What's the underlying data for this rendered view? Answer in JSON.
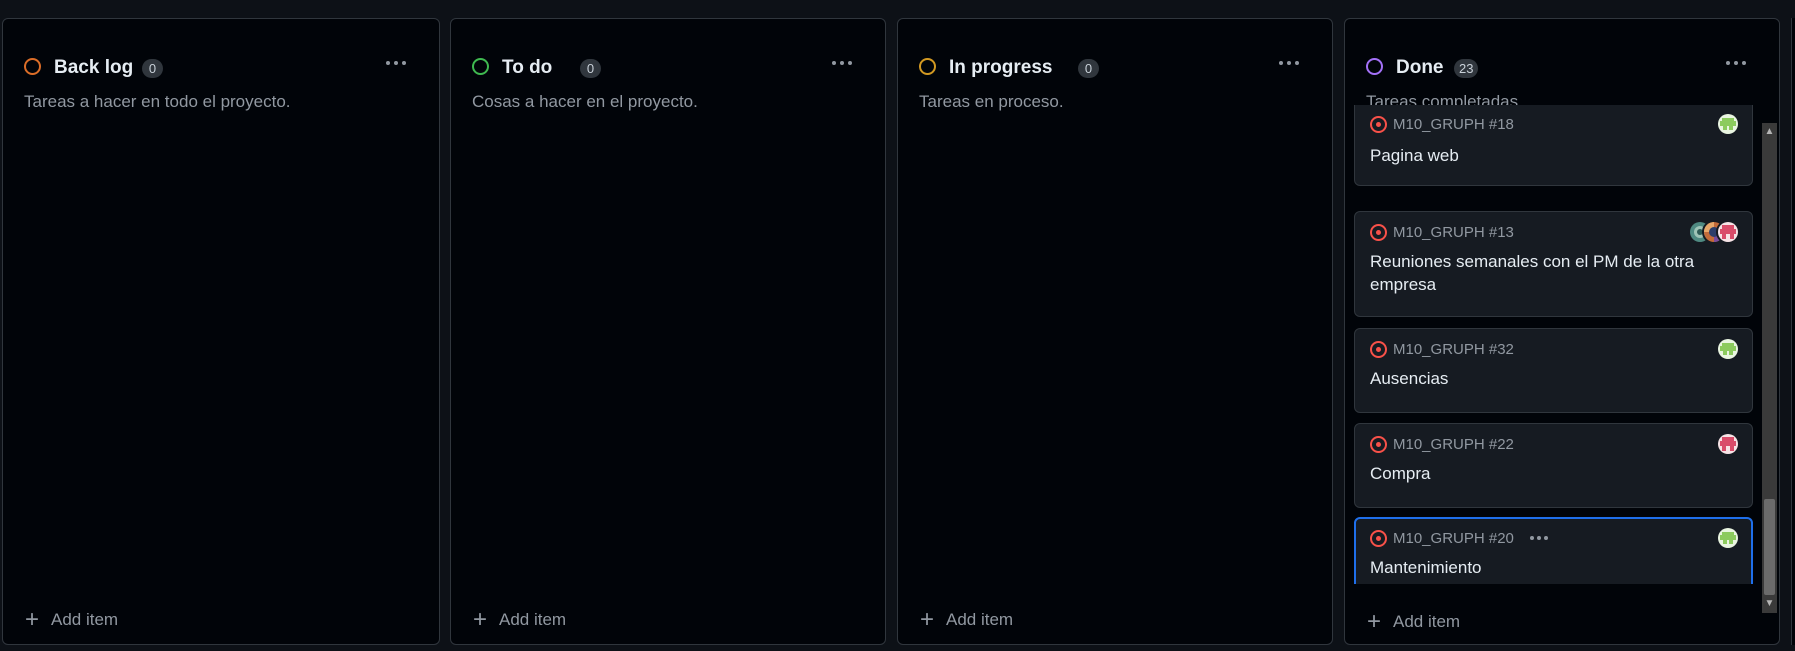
{
  "colors": {
    "backlog": "#db6d28",
    "todo": "#3fb950",
    "inprogress": "#d29922",
    "done": "#a371f7",
    "issue_open": "#f85149",
    "selected_border": "#1f6feb"
  },
  "columns": [
    {
      "title": "Back log",
      "count": "0",
      "description": "Tareas a hacer en todo el proyecto.",
      "add_label": "Add item"
    },
    {
      "title": "To do",
      "count": "0",
      "description": "Cosas a hacer en el proyecto.",
      "add_label": "Add item"
    },
    {
      "title": "In progress",
      "count": "0",
      "description": "Tareas en proceso.",
      "add_label": "Add item"
    },
    {
      "title": "Done",
      "count": "23",
      "description": "Tareas completadas.",
      "add_label": "Add item",
      "cards": [
        {
          "ref": "M10_GRUPH #18",
          "title": "Pagina web",
          "assignees": [
            "green-avatar-icon"
          ]
        },
        {
          "ref": "M10_GRUPH #13",
          "title": "Reuniones semanales con el PM de la otra empresa",
          "assignees": [
            "pink-avatar-icon",
            "multicolor-avatar-icon",
            "teal-avatar-icon"
          ]
        },
        {
          "ref": "M10_GRUPH #32",
          "title": "Ausencias",
          "assignees": [
            "green-avatar-icon"
          ]
        },
        {
          "ref": "M10_GRUPH #22",
          "title": "Compra",
          "assignees": [
            "pink-avatar-icon"
          ]
        },
        {
          "ref": "M10_GRUPH #20",
          "title": "Mantenimiento",
          "assignees": [
            "green-avatar-icon"
          ],
          "selected": true
        }
      ]
    }
  ]
}
